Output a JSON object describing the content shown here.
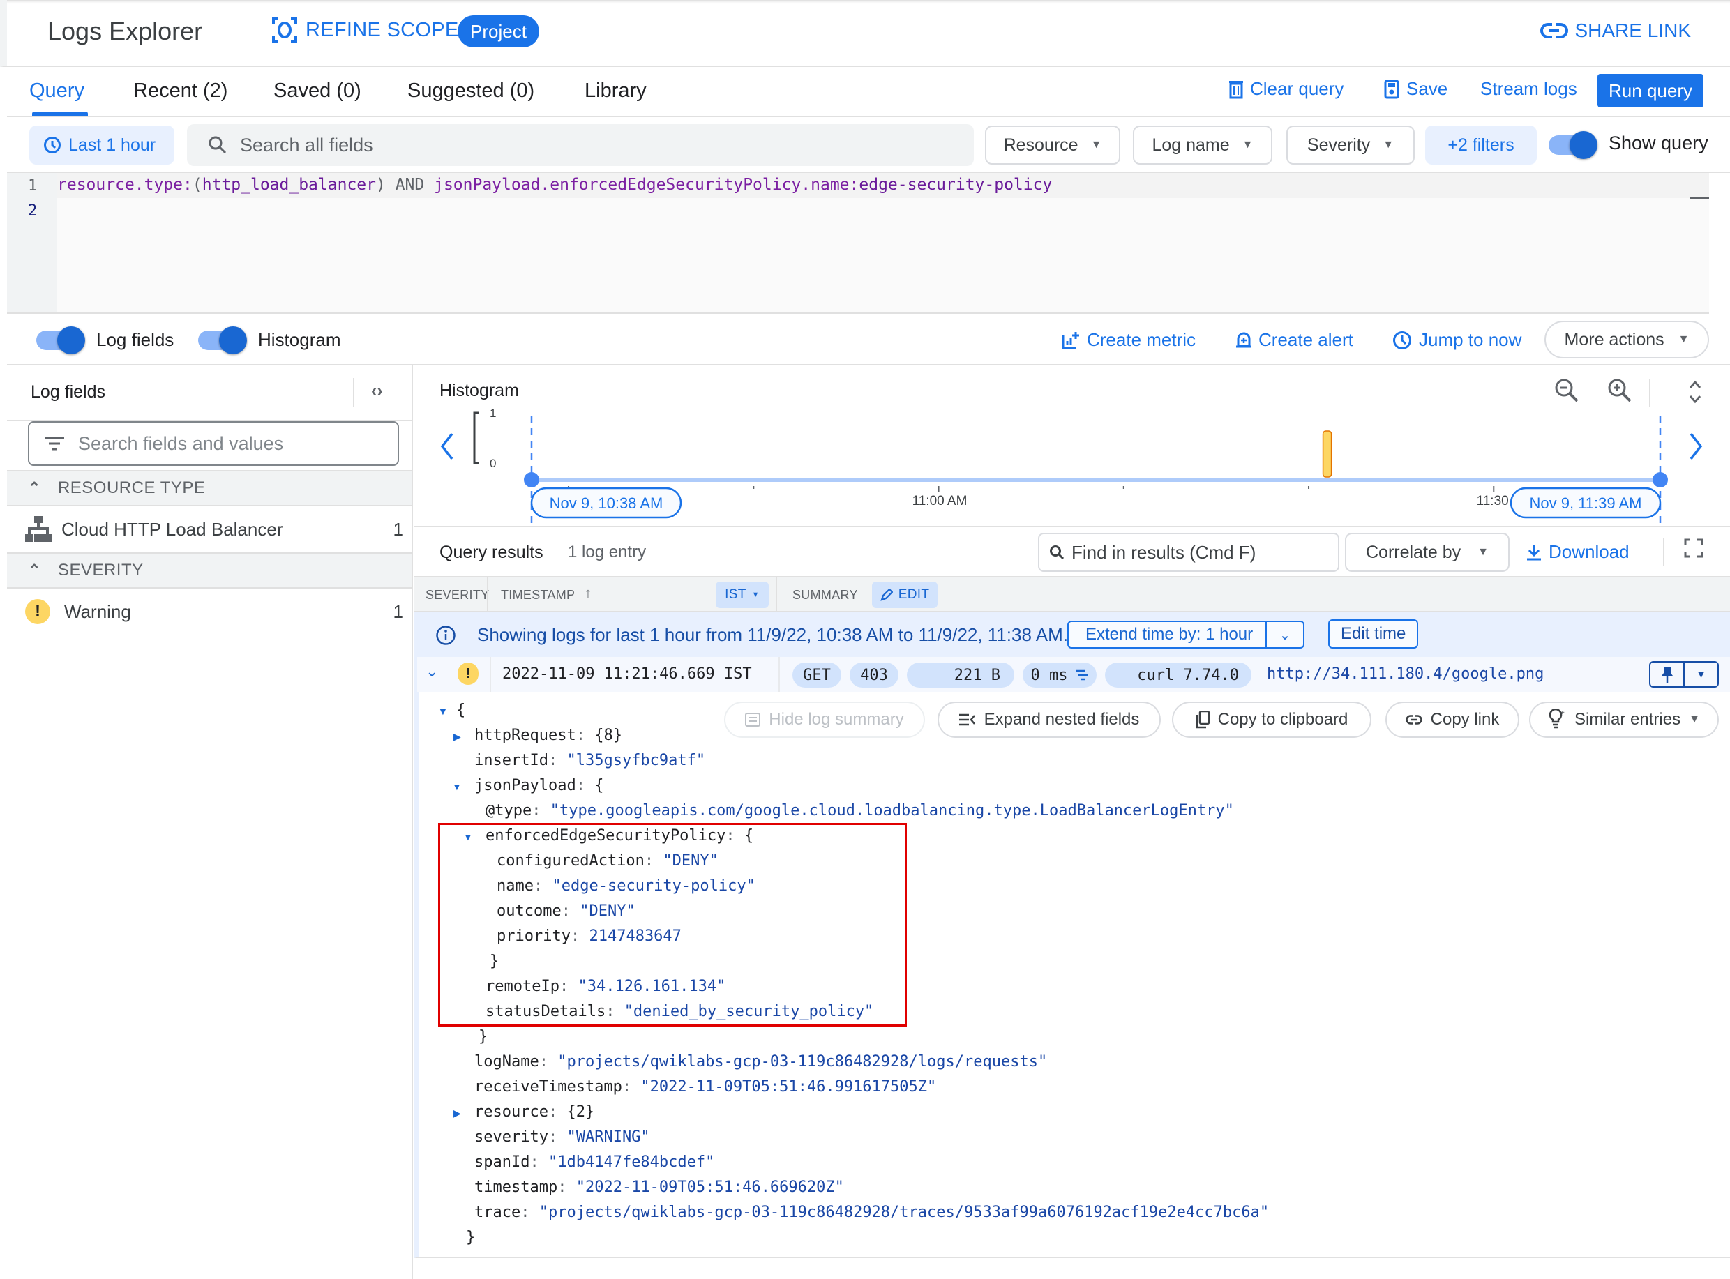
{
  "header": {
    "title": "Logs Explorer",
    "refine_scope": "REFINE SCOPE",
    "scope_badge": "Project",
    "share_link": "SHARE LINK"
  },
  "tabs": [
    {
      "label": "Query",
      "active": true
    },
    {
      "label": "Recent (2)"
    },
    {
      "label": "Saved (0)"
    },
    {
      "label": "Suggested (0)"
    },
    {
      "label": "Library"
    }
  ],
  "toolbar": {
    "clear_query": "Clear query",
    "save": "Save",
    "stream_logs": "Stream logs",
    "run_query": "Run query"
  },
  "filters": {
    "time_range": "Last 1 hour",
    "search_placeholder": "Search all fields",
    "resource": "Resource",
    "log_name": "Log name",
    "severity": "Severity",
    "more_filters": "+2 filters",
    "show_query_label": "Show query",
    "show_query_on": true
  },
  "query_editor": {
    "line_numbers": [
      "1",
      "2"
    ],
    "line1": {
      "field1": "resource.type:",
      "open": "(",
      "value1": "http_load_balancer",
      "close": ")",
      "operator": " AND ",
      "field2": "jsonPayload.enforcedEdgeSecurityPolicy.name:",
      "value2": "edge-security-policy"
    }
  },
  "actions": {
    "log_fields_label": "Log fields",
    "histogram_label": "Histogram",
    "create_metric": "Create metric",
    "create_alert": "Create alert",
    "jump_to_now": "Jump to now",
    "more_actions": "More actions"
  },
  "log_fields_panel": {
    "title": "Log fields",
    "search_placeholder": "Search fields and values",
    "sections": [
      {
        "title": "RESOURCE TYPE",
        "items": [
          {
            "label": "Cloud HTTP Load Balancer",
            "count": "1",
            "icon": "hierarchy-icon"
          }
        ]
      },
      {
        "title": "SEVERITY",
        "items": [
          {
            "label": "Warning",
            "count": "1",
            "icon": "warning-icon"
          }
        ]
      }
    ]
  },
  "histogram": {
    "title": "Histogram",
    "y_max": "1",
    "y_min": "0",
    "start_label": "Nov 9, 10:38 AM",
    "end_label": "Nov 9, 11:39 AM",
    "tick_labels": [
      "11:00 AM",
      "11:30 AM"
    ],
    "bar_color": "#fdd663"
  },
  "chart_data": {
    "type": "bar",
    "title": "Histogram",
    "x_range": [
      "10:38 AM",
      "11:39 AM"
    ],
    "x_ticks": [
      "11:00 AM",
      "11:30 AM"
    ],
    "ylim": [
      0,
      1
    ],
    "series": [
      {
        "name": "Warning",
        "points": [
          {
            "x": "11:21 AM",
            "y": 1
          }
        ]
      }
    ]
  },
  "results": {
    "title": "Query results",
    "count": "1 log entry",
    "find_placeholder": "Find in results (Cmd F)",
    "correlate_by": "Correlate by",
    "download": "Download",
    "columns": {
      "severity": "SEVERITY",
      "timestamp": "TIMESTAMP",
      "timezone": "IST",
      "summary": "SUMMARY",
      "edit": "EDIT"
    },
    "banner": {
      "text": "Showing logs for last 1 hour from 11/9/22, 10:38 AM to 11/9/22, 11:38 AM.",
      "extend": "Extend time by: 1 hour",
      "edit_time": "Edit time"
    },
    "entry": {
      "timestamp": "2022-11-09 11:21:46.669 IST",
      "method": "GET",
      "status": "403",
      "size": "221 B",
      "latency": "0 ms",
      "user_agent": "curl 7.74.0",
      "url": "http://34.111.180.4/google.png"
    },
    "detail_buttons": {
      "hide_summary": "Hide log summary",
      "expand_nested": "Expand nested fields",
      "copy_clipboard": "Copy to clipboard",
      "copy_link": "Copy link",
      "similar_entries": "Similar entries"
    },
    "json": {
      "httpRequest": "{8}",
      "insertId": "\"l35gsyfbc9atf\"",
      "type": "\"type.googleapis.com/google.cloud.loadbalancing.type.LoadBalancerLogEntry\"",
      "configuredAction": "\"DENY\"",
      "name": "\"edge-security-policy\"",
      "outcome": "\"DENY\"",
      "priority": "2147483647",
      "remoteIp": "\"34.126.161.134\"",
      "statusDetails": "\"denied_by_security_policy\"",
      "logName": "\"projects/qwiklabs-gcp-03-119c86482928/logs/requests\"",
      "receiveTimestamp": "\"2022-11-09T05:51:46.991617505Z\"",
      "resource": "{2}",
      "severity": "\"WARNING\"",
      "spanId": "\"1db4147fe84bcdef\"",
      "timestamp": "\"2022-11-09T05:51:46.669620Z\"",
      "trace": "\"projects/qwiklabs-gcp-03-119c86482928/traces/9533af99a6076192acf19e2e4cc7bc6a\""
    }
  }
}
